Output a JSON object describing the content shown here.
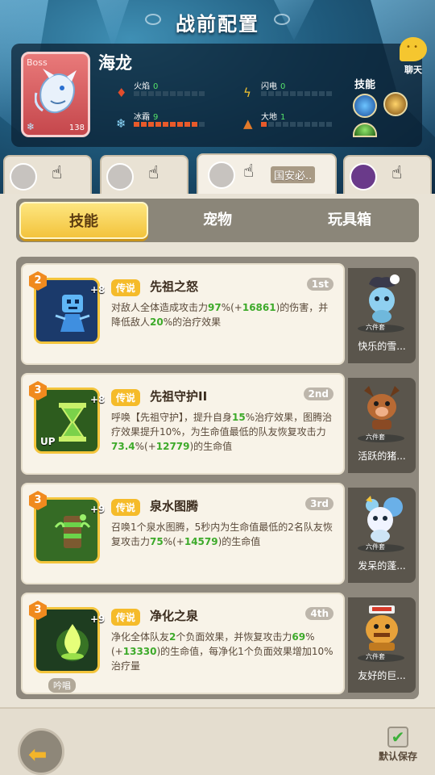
{
  "header": {
    "title": "战前配置"
  },
  "boss": {
    "tag": "Boss",
    "name": "海龙",
    "level": "138",
    "stats": [
      {
        "label": "火焰",
        "value": "0",
        "icon": "fire-icon",
        "level": 0
      },
      {
        "label": "闪电",
        "value": "0",
        "icon": "lightning-icon",
        "level": 0
      },
      {
        "label": "冰霜",
        "value": "9",
        "icon": "snowflake-icon",
        "level": 9
      },
      {
        "label": "大地",
        "value": "1",
        "icon": "earth-icon",
        "level": 1
      }
    ],
    "skills_label": "技能"
  },
  "chat": {
    "label": "聊天"
  },
  "hero_tabs": [
    {
      "name": ""
    },
    {
      "name": ""
    },
    {
      "name": "国安必.."
    },
    {
      "name": ""
    }
  ],
  "tabs": [
    "技能",
    "宠物",
    "玩具箱"
  ],
  "skills": [
    {
      "level": "2",
      "plus": "+8",
      "rarity": "传说",
      "name": "先祖之怒",
      "rank": "1st",
      "desc_parts": [
        "对敌人全体造成攻击力",
        "97",
        "%(+",
        "16861",
        ")的伤害，并降低敌人",
        "20",
        "%的治疗效果"
      ],
      "pet_name": "快乐的雪...",
      "pet_set": "六件套"
    },
    {
      "level": "3",
      "plus": "+8",
      "rarity": "传说",
      "name": "先祖守护II",
      "rank": "2nd",
      "up": "UP",
      "desc_parts": [
        "呼唤【先祖守护】，提升自身",
        "15",
        "%治疗效果，图腾治疗效果提升10%，为生命值最低的队友恢复攻击力",
        "73.4",
        "%(+",
        "12779",
        ")的生命值"
      ],
      "pet_name": "活跃的猪...",
      "pet_set": "六件套"
    },
    {
      "level": "3",
      "plus": "+9",
      "rarity": "传说",
      "name": "泉水图腾",
      "rank": "3rd",
      "desc_parts": [
        "召唤1个泉水图腾，5秒内为生命值最低的2名队友恢复攻击力",
        "75",
        "%(+",
        "14579",
        ")的生命值"
      ],
      "pet_name": "发呆的蓬...",
      "pet_set": "六件套"
    },
    {
      "level": "3",
      "plus": "+9",
      "rarity": "传说",
      "name": "净化之泉",
      "rank": "4th",
      "chant": "吟唱",
      "desc_parts": [
        "净化全体队友",
        "2",
        "个负面效果，并恢复攻击力",
        "69",
        "%(+",
        "13330",
        ")的生命值，每净化1个负面效果增加10%治疗量"
      ],
      "pet_name": "友好的巨...",
      "pet_set": "六件套"
    }
  ],
  "footer": {
    "save_label": "默认保存",
    "save_checked": true
  },
  "colors": {
    "accent": "#f3c33c",
    "green_value": "#3daa2a",
    "rarity": "#f5bb2a"
  }
}
